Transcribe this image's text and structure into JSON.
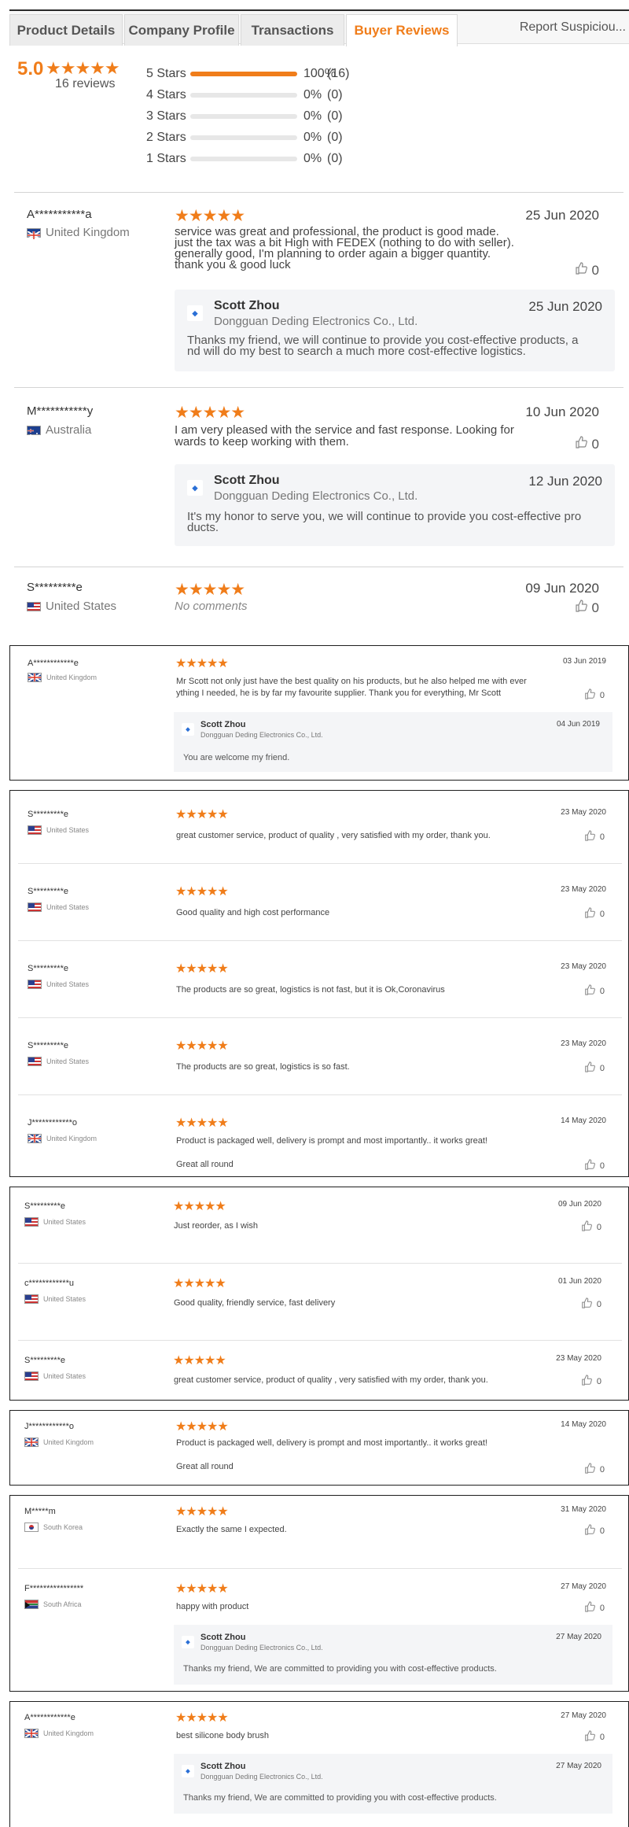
{
  "tabs": [
    {
      "label": "Product Details"
    },
    {
      "label": "Company Profile"
    },
    {
      "label": "Transactions"
    },
    {
      "label": "Buyer Reviews"
    }
  ],
  "report_label": "Report Suspiciou...",
  "summary": {
    "score": "5.0",
    "stars": "★★★★★",
    "review_count": "16 reviews",
    "distribution": [
      {
        "label": "5 Stars",
        "fill": 1.0,
        "pct": "100%",
        "count": "(16)"
      },
      {
        "label": "4 Stars",
        "fill": 0,
        "pct": "0%",
        "count": "(0)"
      },
      {
        "label": "3 Stars",
        "fill": 0,
        "pct": "0%",
        "count": "(0)"
      },
      {
        "label": "2 Stars",
        "fill": 0,
        "pct": "0%",
        "count": "(0)"
      },
      {
        "label": "1 Stars",
        "fill": 0,
        "pct": "0%",
        "count": "(0)"
      }
    ]
  },
  "stars": "★★★★★",
  "like_count": "0",
  "supplier": {
    "name": "Scott Zhou",
    "company": "Dongguan Deding Electronics Co., Ltd."
  },
  "top_reviews": [
    {
      "name": "A***********a",
      "country": "United Kingdom",
      "flag": "uk",
      "date": "25 Jun 2020",
      "text": "service was great and professional, the product is good made.\njust the tax was a bit High with FEDEX (nothing to do with seller).\ngenerally good, I'm planning to order again a bigger quantity.\nthank you & good luck",
      "reply_date": "25 Jun 2020",
      "reply_text": "Thanks my friend, we will continue to provide you cost-effective products, a\nnd will do my best to search a much more cost-effective logistics."
    },
    {
      "name": "M***********y",
      "country": "Australia",
      "flag": "au",
      "date": "10 Jun 2020",
      "text": "I am very pleased with the service and fast response. Looking for\nwards to keep working with them.",
      "reply_date": "12 Jun 2020",
      "reply_text": "It's my honor to serve you, we will continue to provide you cost-effective pro\nducts."
    },
    {
      "name": "S*********e",
      "country": "United States",
      "flag": "us",
      "date": "09 Jun 2020",
      "text": "No comments"
    }
  ],
  "frame1": {
    "name": "A************e",
    "country": "United Kingdom",
    "date": "03 Jun 2019",
    "text": "Mr Scott not only just have the best quality on his products, but he also helped me with ever\nything I needed, he is by far my favourite supplier. Thank you for everything, Mr Scott",
    "reply_date": "04 Jun 2019",
    "reply_text": "You are welcome my friend."
  },
  "frame2": [
    {
      "name": "S*********e",
      "country": "United States",
      "date": "23 May 2020",
      "text": "great customer service, product of quality , very satisfied with my order, thank you."
    },
    {
      "name": "S*********e",
      "country": "United States",
      "date": "23 May 2020",
      "text": "Good quality and high cost performance"
    },
    {
      "name": "S*********e",
      "country": "United States",
      "date": "23 May 2020",
      "text": "The products are so great, logistics is not fast, but it is Ok,Coronavirus"
    },
    {
      "name": "S*********e",
      "country": "United States",
      "date": "23 May 2020",
      "text": "The products are so great, logistics is so fast."
    },
    {
      "name": "J************o",
      "country": "United Kingdom",
      "date": "14 May 2020",
      "text": "Product is packaged well, delivery is prompt and most importantly.. it works great!\n\nGreat all round"
    }
  ],
  "frame3": [
    {
      "name": "S*********e",
      "country": "United States",
      "date": "09 Jun 2020",
      "text": "Just reorder, as I wish"
    },
    {
      "name": "c************u",
      "country": "United States",
      "date": "01 Jun 2020",
      "text": "Good quality, friendly service, fast delivery"
    },
    {
      "name": "S*********e",
      "country": "United States",
      "date": "23 May 2020",
      "text": "great customer service, product of quality , very satisfied with my order, thank you."
    }
  ],
  "frame4": {
    "name": "J************o",
    "country": "United Kingdom",
    "date": "14 May 2020",
    "text": "Product is packaged well, delivery is prompt and most importantly.. it works great!\n\nGreat all round"
  },
  "frame5": [
    {
      "name": "M*****m",
      "country": "South Korea",
      "date": "31 May 2020",
      "text": "Exactly the same I expected."
    },
    {
      "name": "F****************",
      "country": "South Africa",
      "date": "27 May 2020",
      "text": "happy with product",
      "reply_date": "27 May 2020",
      "reply_text": "Thanks my friend, We are committed to providing you with cost-effective products."
    }
  ],
  "frame6": {
    "name": "A************e",
    "country": "United Kingdom",
    "date": "27 May 2020",
    "text": "best silicone body brush",
    "reply_date": "27 May 2020",
    "reply_text": "Thanks my friend, We are committed to providing you with cost-effective products."
  }
}
